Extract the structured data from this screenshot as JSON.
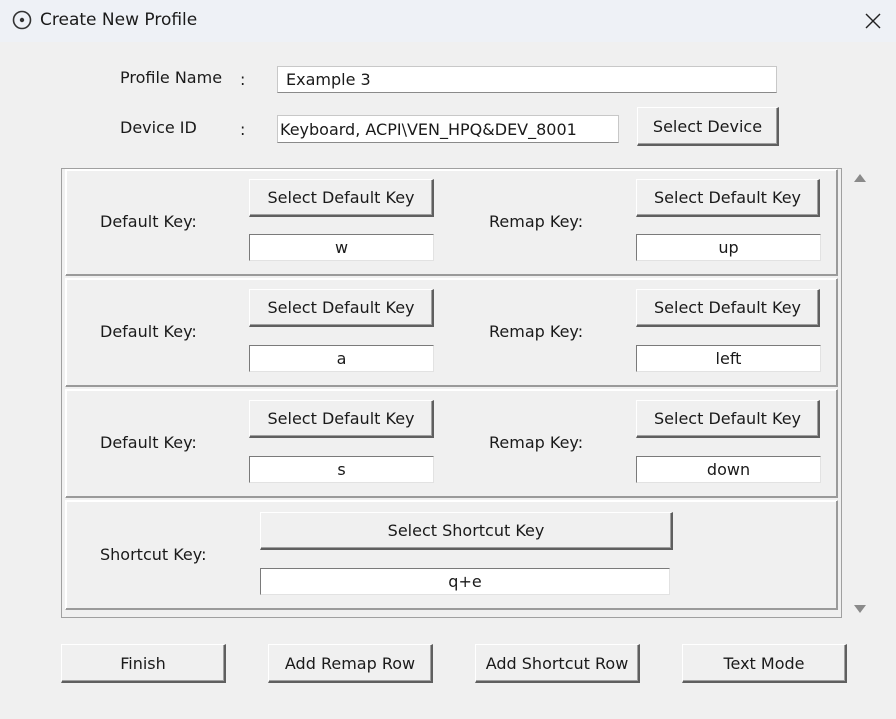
{
  "window": {
    "title": "Create New Profile"
  },
  "form": {
    "profile_name_label": "Profile Name",
    "profile_name_value": "Example 3",
    "device_id_label": "Device ID",
    "device_id_value": "Keyboard, ACPI\\VEN_HPQ&DEV_8001",
    "colon": ":",
    "select_device_label": "Select Device"
  },
  "rows": [
    {
      "default_label": "Default Key:",
      "default_button": "Select Default Key",
      "default_value": "w",
      "remap_label": "Remap Key:",
      "remap_button": "Select Default Key",
      "remap_value": "up"
    },
    {
      "default_label": "Default Key:",
      "default_button": "Select Default Key",
      "default_value": "a",
      "remap_label": "Remap Key:",
      "remap_button": "Select Default Key",
      "remap_value": "left"
    },
    {
      "default_label": "Default Key:",
      "default_button": "Select Default Key",
      "default_value": "s",
      "remap_label": "Remap Key:",
      "remap_button": "Select Default Key",
      "remap_value": "down"
    }
  ],
  "shortcut": {
    "label": "Shortcut Key:",
    "button": "Select Shortcut Key",
    "value": "q+e"
  },
  "footer": {
    "finish": "Finish",
    "add_remap_row": "Add Remap Row",
    "add_shortcut_row": "Add Shortcut Row",
    "text_mode": "Text Mode"
  },
  "icons": {
    "title": "disc-icon",
    "close": "close-icon",
    "scroll_up": "triangle-up-icon",
    "scroll_down": "triangle-down-icon"
  }
}
